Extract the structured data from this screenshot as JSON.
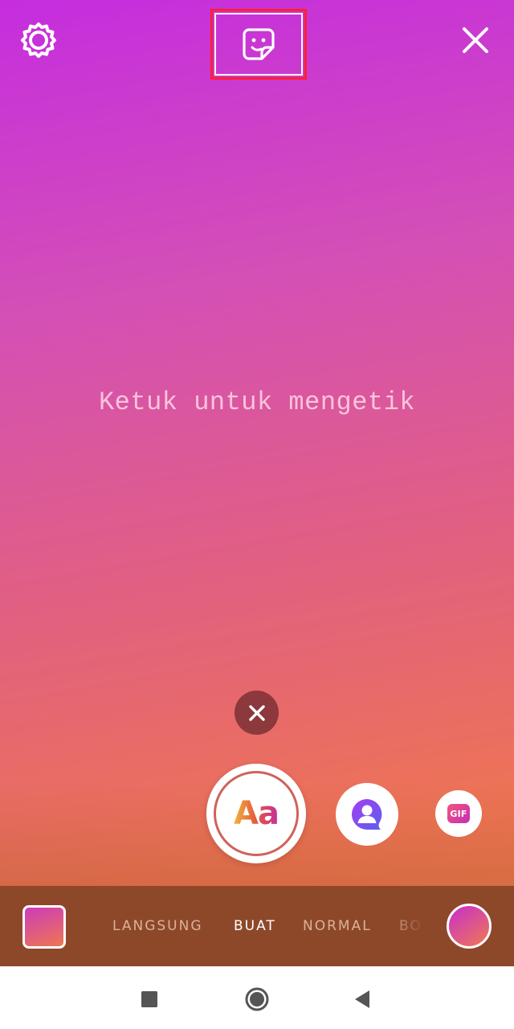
{
  "top_bar": {
    "settings_icon": "gear-icon",
    "sticker_icon": "sticker-icon",
    "close_icon": "close-icon"
  },
  "canvas": {
    "placeholder": "Ketuk untuk mengetik"
  },
  "tools": {
    "dismiss_icon": "close-icon",
    "text_style_label": "Aa",
    "mention_icon": "mention-icon",
    "gif_label": "GIF"
  },
  "mode_bar": {
    "gallery_icon": "gallery-thumbnail",
    "modes": [
      "LANGSUNG",
      "BUAT",
      "NORMAL",
      "BO"
    ],
    "active_mode": "BUAT",
    "color_picker_icon": "color-swatch"
  },
  "system_nav": {
    "recent_icon": "square-icon",
    "home_icon": "circle-icon",
    "back_icon": "triangle-left-icon"
  },
  "colors": {
    "gradient_top": "#c52ddf",
    "gradient_bottom": "#f07c45",
    "highlight_border": "#ff2030",
    "mode_bar_bg": "#8d482a"
  }
}
